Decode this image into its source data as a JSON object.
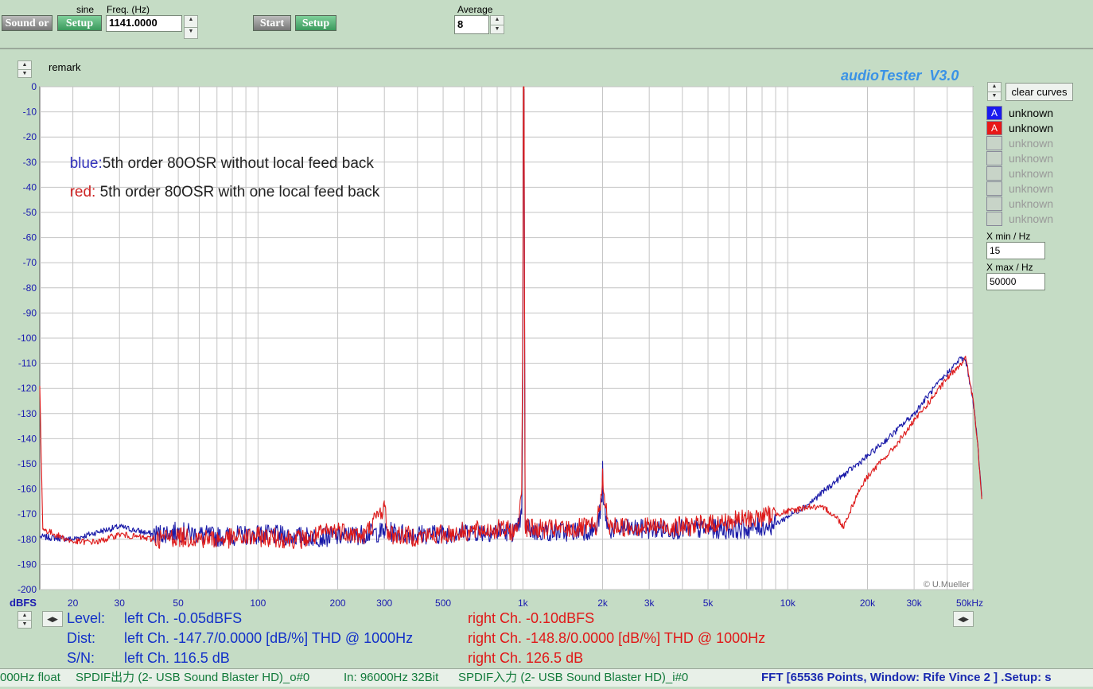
{
  "toolbar": {
    "sound_label": "Sound or",
    "gen_setup_label": "Setup",
    "waveform_label": "sine",
    "freq_label": "Freq. (Hz)",
    "freq_value": "1141.0000",
    "start_label": "Start",
    "analyzer_setup_label": "Setup",
    "average_label": "Average",
    "average_value": "8"
  },
  "header": {
    "remark_label": "remark",
    "app_title": "audioTester  V3.0"
  },
  "annotations": [
    {
      "prefix": "blue:",
      "text": "5th order 80OSR without local feed back",
      "color": "#3333bb"
    },
    {
      "prefix": "red:",
      "text": " 5th order 80OSR with one local feed back",
      "color": "#cc2222"
    }
  ],
  "copyright": "© U.Mueller",
  "legend": {
    "clear_label": "clear curves",
    "items": [
      {
        "badge": "A",
        "label": "unknown",
        "color": "#1a1aee",
        "active": true
      },
      {
        "badge": "A",
        "label": "unknown",
        "color": "#e81818",
        "active": true
      },
      {
        "badge": "",
        "label": "unknown",
        "color": "#c8d4c8",
        "active": false
      },
      {
        "badge": "",
        "label": "unknown",
        "color": "#c8d4c8",
        "active": false
      },
      {
        "badge": "",
        "label": "unknown",
        "color": "#c8d4c8",
        "active": false
      },
      {
        "badge": "",
        "label": "unknown",
        "color": "#c8d4c8",
        "active": false
      },
      {
        "badge": "",
        "label": "unknown",
        "color": "#c8d4c8",
        "active": false
      },
      {
        "badge": "",
        "label": "unknown",
        "color": "#c8d4c8",
        "active": false
      }
    ]
  },
  "range": {
    "xmin_label": "X min / Hz",
    "xmin_value": "15",
    "xmax_label": "X max / Hz",
    "xmax_value": "50000"
  },
  "measurements": {
    "level_label": "Level:",
    "dist_label": "Dist:",
    "sn_label": "S/N:",
    "left_level": "left Ch. -0.05dBFS",
    "right_level": "right Ch. -0.10dBFS",
    "left_dist": "left Ch. -147.7/0.0000 [dB/%] THD @ 1000Hz",
    "right_dist": "right Ch. -148.8/0.0000 [dB/%] THD @ 1000Hz",
    "left_sn": "left Ch. 116.5 dB",
    "right_sn": "right Ch. 126.5 dB"
  },
  "status": {
    "seg1": "000Hz float",
    "seg2": "SPDIF出力 (2- USB Sound Blaster HD)_o#0",
    "seg3": "In: 96000Hz 32Bit",
    "seg4": "SPDIF入力 (2- USB Sound Blaster HD)_i#0",
    "seg5": "FFT [65536 Points, Window: Rife Vince 2 ]  .Setup: s"
  },
  "colors": {
    "background": "#c5dcc5",
    "plot_bg": "#ffffff",
    "grid": "#c4c4c4",
    "blue_curve": "#1a1aa8",
    "red_curve": "#dd1a1a",
    "axis_text": "#1a1ab0"
  },
  "chart_data": {
    "type": "line",
    "xscale": "log",
    "xlim": [
      15,
      50000
    ],
    "ylim": [
      -200,
      0
    ],
    "xlabel": "",
    "ylabel": "dBFS",
    "grid": true,
    "x_ticks": [
      {
        "v": 20,
        "label": "20"
      },
      {
        "v": 30,
        "label": "30"
      },
      {
        "v": 50,
        "label": "50"
      },
      {
        "v": 100,
        "label": "100"
      },
      {
        "v": 200,
        "label": "200"
      },
      {
        "v": 300,
        "label": "300"
      },
      {
        "v": 500,
        "label": "500"
      },
      {
        "v": 1000,
        "label": "1k"
      },
      {
        "v": 2000,
        "label": "2k"
      },
      {
        "v": 3000,
        "label": "3k"
      },
      {
        "v": 5000,
        "label": "5k"
      },
      {
        "v": 10000,
        "label": "10k"
      },
      {
        "v": 20000,
        "label": "20k"
      },
      {
        "v": 30000,
        "label": "30k"
      },
      {
        "v": 50000,
        "label": "50kHz"
      }
    ],
    "y_ticks": [
      0,
      -10,
      -20,
      -30,
      -40,
      -50,
      -60,
      -70,
      -80,
      -90,
      -100,
      -110,
      -120,
      -130,
      -140,
      -150,
      -160,
      -170,
      -180,
      -190,
      -200
    ],
    "series": [
      {
        "color": "#1a1aa8",
        "points": [
          [
            15,
            -179
          ],
          [
            20,
            -180
          ],
          [
            25,
            -177
          ],
          [
            30,
            -175
          ],
          [
            40,
            -178
          ],
          [
            50,
            -177
          ],
          [
            70,
            -179
          ],
          [
            100,
            -178
          ],
          [
            150,
            -179
          ],
          [
            200,
            -179
          ],
          [
            250,
            -178
          ],
          [
            300,
            -177
          ],
          [
            400,
            -178
          ],
          [
            500,
            -178
          ],
          [
            600,
            -177
          ],
          [
            800,
            -177
          ],
          [
            950,
            -177
          ],
          [
            990,
            -170
          ],
          [
            1000,
            -100
          ],
          [
            1005,
            -1
          ],
          [
            1010,
            -1
          ],
          [
            1020,
            -175
          ],
          [
            1100,
            -177
          ],
          [
            1500,
            -177
          ],
          [
            1900,
            -176
          ],
          [
            1990,
            -165
          ],
          [
            2000,
            -149
          ],
          [
            2010,
            -165
          ],
          [
            2100,
            -176
          ],
          [
            3000,
            -176
          ],
          [
            4000,
            -176
          ],
          [
            5000,
            -176
          ],
          [
            6000,
            -176
          ],
          [
            7000,
            -176
          ],
          [
            8000,
            -175
          ],
          [
            9000,
            -174
          ],
          [
            10000,
            -171
          ],
          [
            12000,
            -166
          ],
          [
            14000,
            -160
          ],
          [
            16000,
            -155
          ],
          [
            20000,
            -147
          ],
          [
            25000,
            -138
          ],
          [
            30000,
            -130
          ],
          [
            35000,
            -121
          ],
          [
            40000,
            -114
          ],
          [
            45000,
            -108
          ],
          [
            47000,
            -109
          ],
          [
            50000,
            -124
          ],
          [
            52000,
            -141
          ],
          [
            54000,
            -163
          ]
        ]
      },
      {
        "color": "#dd1a1a",
        "points": [
          [
            15,
            -119
          ],
          [
            15.4,
            -176
          ],
          [
            20,
            -181
          ],
          [
            25,
            -181
          ],
          [
            30,
            -178
          ],
          [
            40,
            -180
          ],
          [
            50,
            -179
          ],
          [
            70,
            -180
          ],
          [
            100,
            -179
          ],
          [
            150,
            -180
          ],
          [
            200,
            -176
          ],
          [
            250,
            -179
          ],
          [
            300,
            -167
          ],
          [
            310,
            -178
          ],
          [
            400,
            -179
          ],
          [
            500,
            -178
          ],
          [
            600,
            -177
          ],
          [
            800,
            -176
          ],
          [
            950,
            -177
          ],
          [
            990,
            -160
          ],
          [
            1000,
            -90
          ],
          [
            1005,
            0
          ],
          [
            1010,
            0
          ],
          [
            1020,
            -175
          ],
          [
            1100,
            -176
          ],
          [
            1500,
            -176
          ],
          [
            1900,
            -175
          ],
          [
            1990,
            -160
          ],
          [
            2000,
            -152
          ],
          [
            2010,
            -160
          ],
          [
            2100,
            -175
          ],
          [
            3000,
            -175
          ],
          [
            4000,
            -175
          ],
          [
            5000,
            -174
          ],
          [
            6000,
            -173
          ],
          [
            8000,
            -171
          ],
          [
            10000,
            -169
          ],
          [
            12000,
            -167
          ],
          [
            14000,
            -168
          ],
          [
            15500,
            -172
          ],
          [
            16200,
            -175
          ],
          [
            17000,
            -170
          ],
          [
            18500,
            -161
          ],
          [
            20000,
            -155
          ],
          [
            25000,
            -144
          ],
          [
            30000,
            -133
          ],
          [
            35000,
            -124
          ],
          [
            40000,
            -116
          ],
          [
            45000,
            -110
          ],
          [
            47000,
            -108
          ],
          [
            50000,
            -124
          ],
          [
            52000,
            -141
          ],
          [
            54000,
            -164
          ]
        ]
      }
    ]
  }
}
